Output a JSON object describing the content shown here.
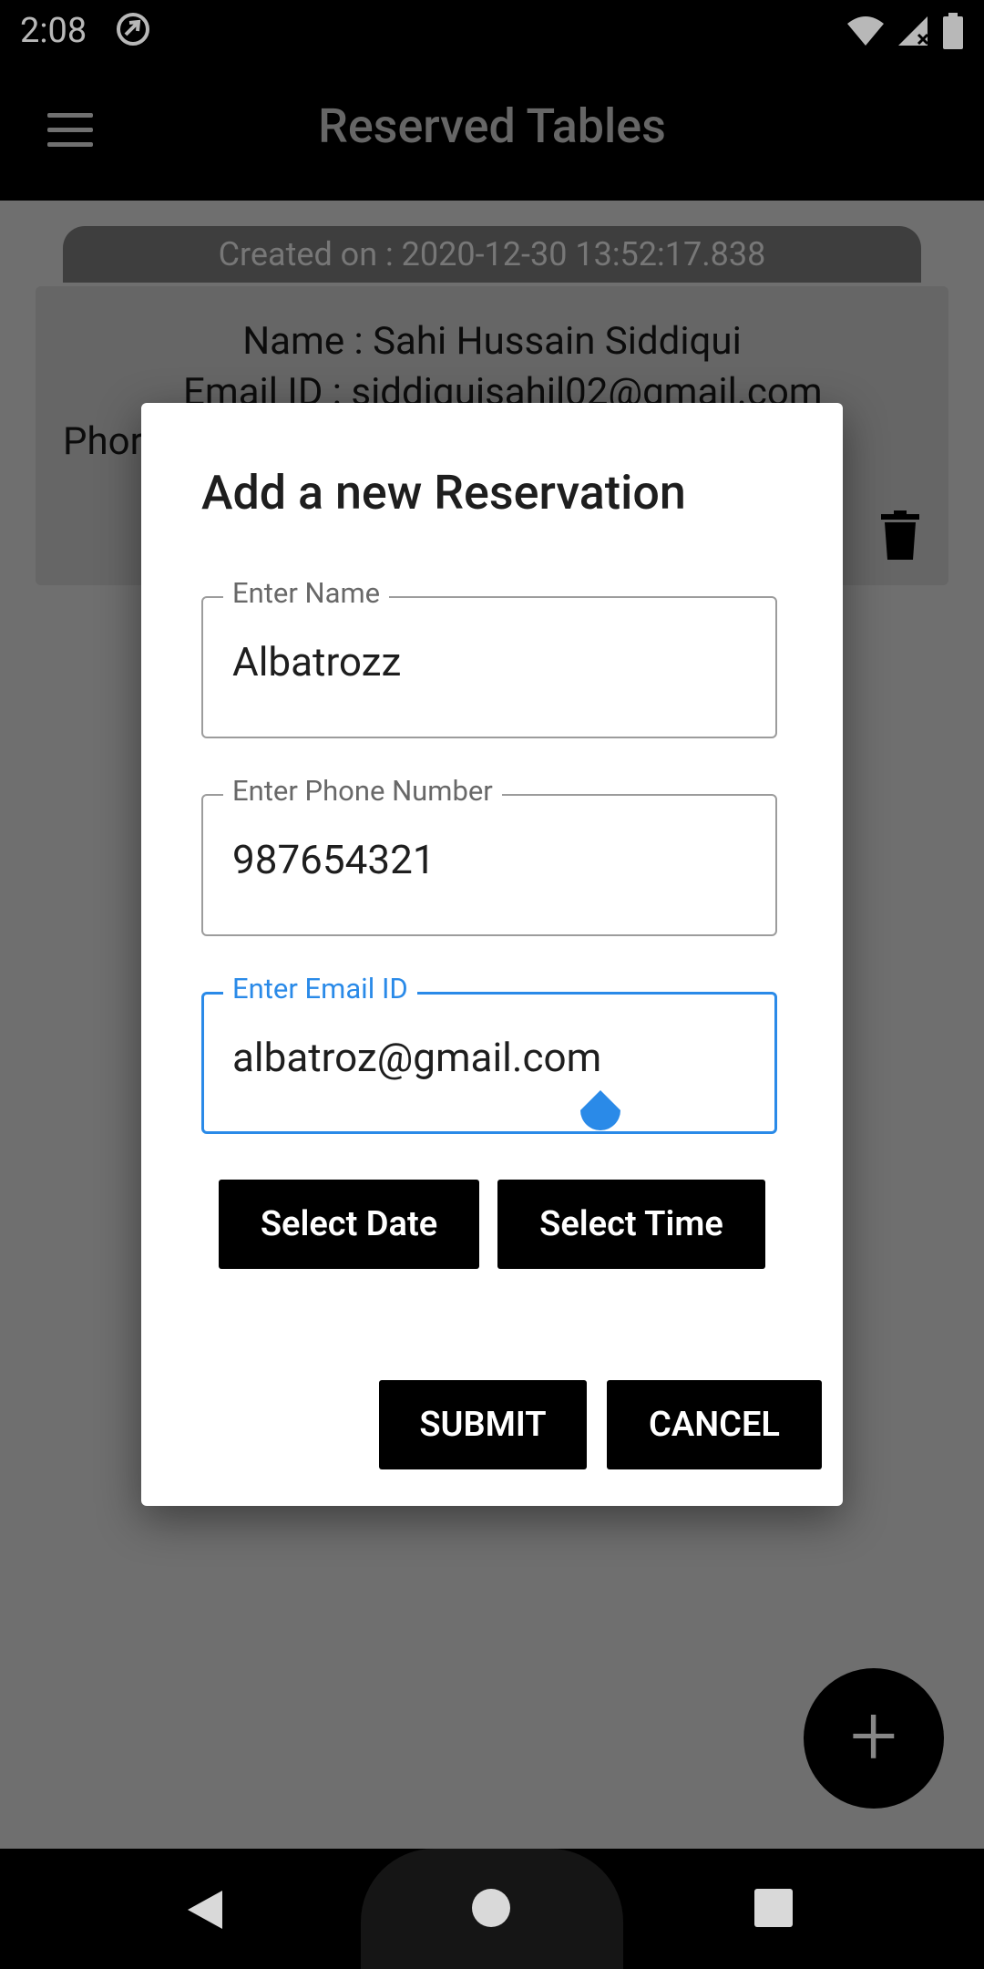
{
  "status": {
    "time": "2:08",
    "icons": [
      "app-notification-icon",
      "wifi-icon",
      "cell-signal-icon",
      "battery-icon"
    ]
  },
  "appbar": {
    "title": "Reserved Tables",
    "menu_icon": "hamburger-menu-icon"
  },
  "reservation_card": {
    "created": "Created on : 2020-12-30 13:52:17.838",
    "name": "Name : Sahi Hussain Siddiqui",
    "email": "Email ID : siddiquisahil02@gmail.com",
    "phone": "Phor",
    "delete_icon": "trash-icon"
  },
  "dialog": {
    "title": "Add a new Reservation",
    "fields": [
      {
        "label": "Enter Name",
        "value": "Albatrozz"
      },
      {
        "label": "Enter Phone Number",
        "value": "987654321"
      },
      {
        "label": "Enter Email ID",
        "value": "albatroz@gmail.com"
      }
    ],
    "select_date": "Select Date",
    "select_time": "Select Time",
    "submit": "SUBMIT",
    "cancel": "CANCEL",
    "accent_color": "#2a8ae8"
  },
  "fab": {
    "label": "+",
    "icon": "add-icon"
  },
  "navbar": {
    "icons": [
      "back-icon",
      "home-icon",
      "recents-icon"
    ]
  }
}
